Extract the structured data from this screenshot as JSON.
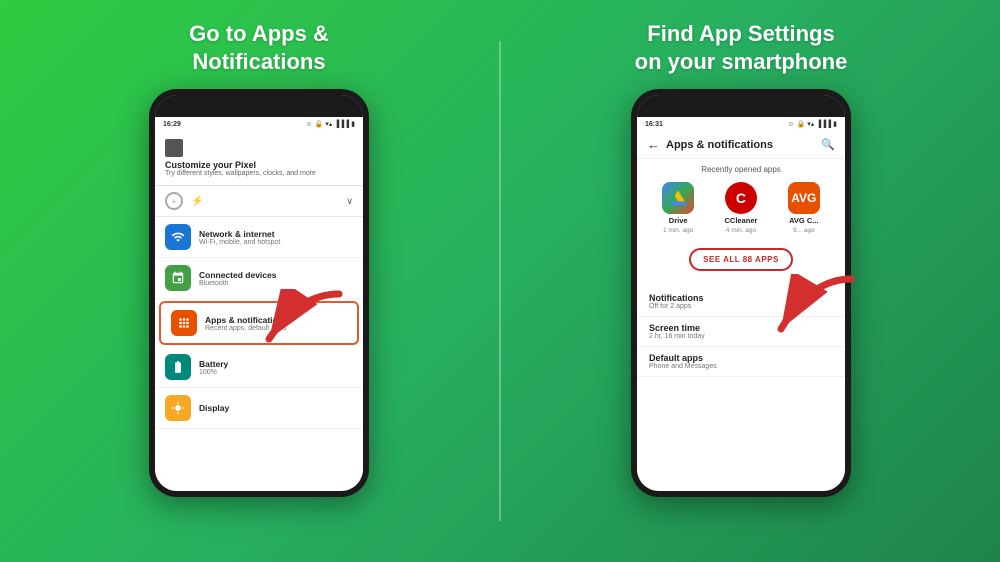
{
  "left_panel": {
    "title": "Go to Apps &\nNotifications",
    "phone": {
      "status_time": "16:29",
      "header": {
        "customize_title": "Customize your Pixel",
        "customize_sub": "Try different styles, wallpapers, clocks, and more"
      },
      "items": [
        {
          "id": "network",
          "icon_color": "blue",
          "icon": "📶",
          "label": "Network & internet",
          "sublabel": "Wi-Fi, mobile, and hotspot"
        },
        {
          "id": "connected",
          "icon_color": "green",
          "icon": "⊞",
          "label": "Connected devices",
          "sublabel": "Bluetooth"
        },
        {
          "id": "apps",
          "icon_color": "orange",
          "icon": "⊞",
          "label": "Apps & notifications",
          "sublabel": "Recent apps, default apps",
          "highlighted": true
        },
        {
          "id": "battery",
          "icon_color": "teal",
          "icon": "🔋",
          "label": "Battery",
          "sublabel": "100%"
        },
        {
          "id": "display",
          "icon_color": "amber",
          "icon": "☀",
          "label": "Display",
          "sublabel": ""
        }
      ]
    }
  },
  "right_panel": {
    "title": "Find App Settings\non your smartphone",
    "phone": {
      "status_time": "16:31",
      "header": {
        "title": "Apps & notifications",
        "back_icon": "←",
        "search_icon": "🔍"
      },
      "recently_label": "Recently opened apps",
      "apps": [
        {
          "name": "Drive",
          "time": "1 min. ago",
          "icon": "🔺",
          "color": "#4285f4"
        },
        {
          "name": "CCleaner",
          "time": "4 min. ago",
          "icon": "C",
          "color": "#cc0000"
        },
        {
          "name": "AVG C...",
          "time": "9... ago",
          "icon": "A",
          "color": "#e65100"
        }
      ],
      "see_all_label": "SEE ALL 88 APPS",
      "settings_items": [
        {
          "label": "Notifications",
          "sublabel": "Off for 2 apps"
        },
        {
          "label": "Screen time",
          "sublabel": "2 hr, 16 min today"
        },
        {
          "label": "Default apps",
          "sublabel": "Phone and Messages"
        }
      ]
    }
  }
}
